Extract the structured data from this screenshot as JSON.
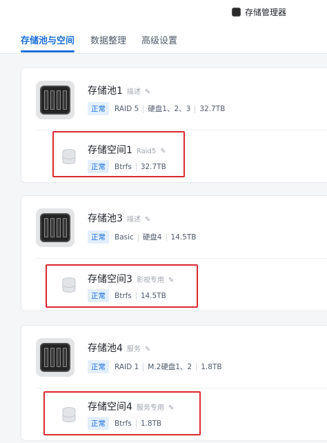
{
  "app": {
    "title": "存储管理器",
    "icon": "storage-manager-icon"
  },
  "tabs": [
    {
      "label": "存储池与空间",
      "active": true
    },
    {
      "label": "数据整理",
      "active": false
    },
    {
      "label": "高级设置",
      "active": false
    }
  ],
  "colors": {
    "accent": "#1a6fd8",
    "badge_bg": "#e3efff",
    "highlight": "#d9272e"
  },
  "pools": [
    {
      "name": "存储池1",
      "desc": "描述",
      "status": "正常",
      "meta": [
        "RAID 5",
        "硬盘1、2、3",
        "32.7TB"
      ],
      "volume": {
        "name": "存储空间1",
        "desc": "Raid5",
        "status": "正常",
        "meta": [
          "Btrfs",
          "32.7TB"
        ]
      }
    },
    {
      "name": "存储池3",
      "desc": "描述",
      "status": "正常",
      "meta": [
        "Basic",
        "硬盘4",
        "14.5TB"
      ],
      "volume": {
        "name": "存储空间3",
        "desc": "影视专用",
        "status": "正常",
        "meta": [
          "Btrfs",
          "14.5TB"
        ]
      }
    },
    {
      "name": "存储池4",
      "desc": "服务",
      "status": "正常",
      "meta": [
        "RAID 1",
        "M.2硬盘1、2",
        "1.8TB"
      ],
      "volume": {
        "name": "存储空间4",
        "desc": "服务专用",
        "status": "正常",
        "meta": [
          "Btrfs",
          "1.8TB"
        ]
      }
    }
  ]
}
